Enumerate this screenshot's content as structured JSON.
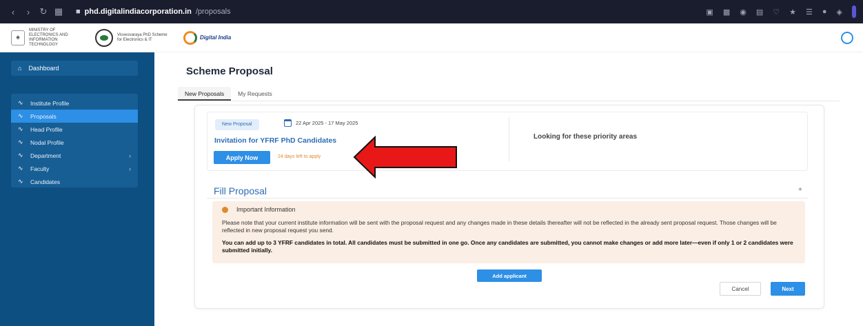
{
  "browser": {
    "url_host": "phd.digitalindiacorporation.in",
    "url_path": "/proposals"
  },
  "header": {
    "emblem_text": "MINISTRY OF ELECTRONICS AND INFORMATION TECHNOLOGY",
    "scheme_text": "Visvesvaraya PhD Scheme for Electronics & IT",
    "digital_india": "Digital India"
  },
  "sidebar": {
    "dashboard": "Dashboard",
    "items": [
      {
        "label": "Institute Profile"
      },
      {
        "label": "Proposals"
      },
      {
        "label": "Head Profile"
      },
      {
        "label": "Nodal Profile"
      },
      {
        "label": "Department"
      },
      {
        "label": "Faculty"
      },
      {
        "label": "Candidates"
      }
    ]
  },
  "main": {
    "title": "Scheme Proposal",
    "tabs": [
      {
        "label": "New Proposals"
      },
      {
        "label": "My Requests"
      }
    ],
    "proposal": {
      "badge": "New Proposal",
      "dates": "22 Apr 2025 - 17 May 2025",
      "title": "Invitation for YFRF PhD Candidates",
      "apply_label": "Apply Now",
      "days_left": "24 days left to apply",
      "priority_title": "Looking for these priority areas"
    },
    "fill": {
      "title": "Fill Proposal",
      "plus": "+",
      "info_heading": "Important Information",
      "info_p1": "Please note that your current institute information will be sent with the proposal request and any changes made in these details thereafter will not be reflected in the already sent proposal request. Those changes will be reflected in new proposal request you send.",
      "info_p2": "You can add up to 3 YFRF candidates in total. All candidates must be submitted in one go. Once any candidates are submitted, you cannot make changes or add more later—even if only 1 or 2 candidates were submitted initially.",
      "add_label": "Add applicant",
      "cancel_label": "Cancel",
      "next_label": "Next"
    }
  },
  "colors": {
    "sidebar": "#0e4f82",
    "accent": "#2d8fe6",
    "info_bg": "#fbeee4",
    "arrow": "#e81818"
  }
}
